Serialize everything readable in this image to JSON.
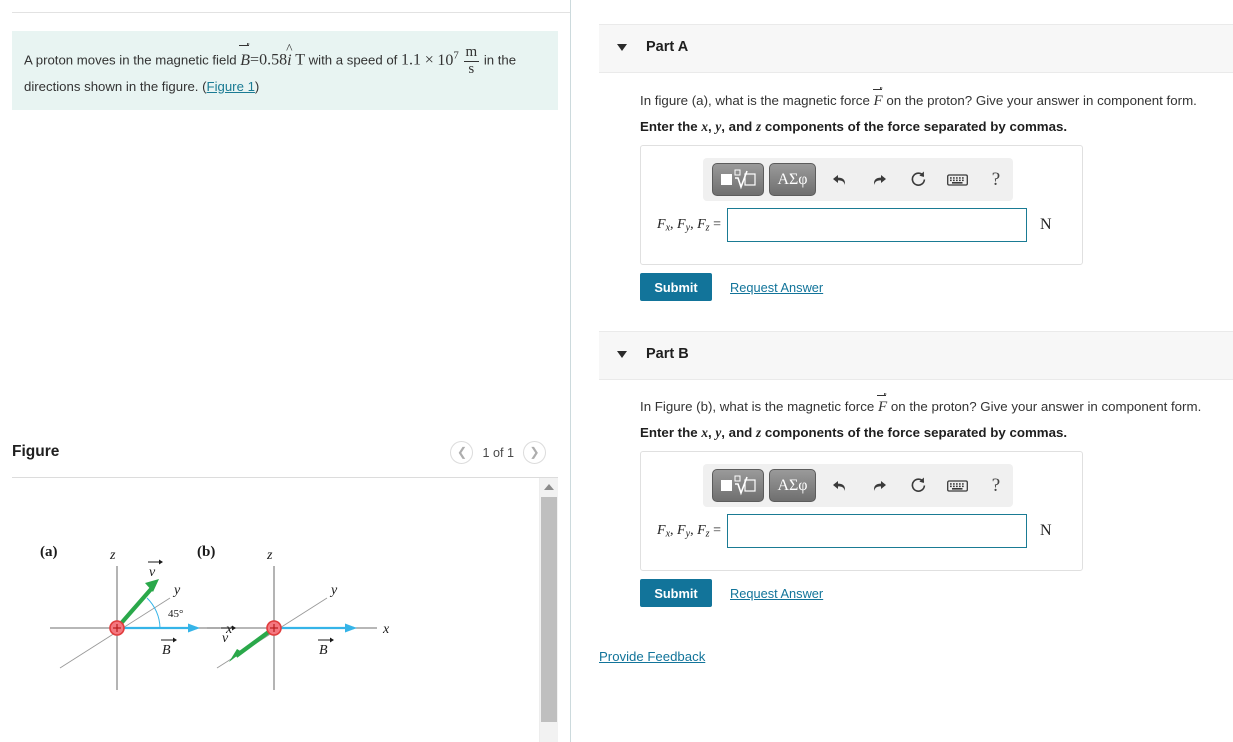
{
  "problem": {
    "text_before_B": "A proton moves in the magnetic field ",
    "B_symbol": "B",
    "equals": "=",
    "B_value": "0.58",
    "i_hat": "i",
    "hat_glyph": "^",
    "tesla_unit": "T",
    "text_mid": " with a speed of ",
    "speed_mantissa": "1.1",
    "times": "×",
    "speed_base": "10",
    "speed_exponent": "7",
    "speed_unit_num": "m",
    "speed_unit_den": "s",
    "text_after": " in the",
    "line2_before_link": "directions shown in the figure. (",
    "figure_link": "Figure 1",
    "line2_after_link": ")"
  },
  "figure": {
    "title": "Figure",
    "pager_label": "1 of 1",
    "prev_icon": "chevron-left-icon",
    "next_icon": "chevron-right-icon",
    "scroll_up_icon": "scroll-up-arrow-icon",
    "panels": [
      {
        "tag": "(a)",
        "axis_z": "z",
        "axis_y": "y",
        "axis_x": "x",
        "vector_v": "v",
        "vector_B": "B",
        "angle_label": "45°"
      },
      {
        "tag": "(b)",
        "axis_z": "z",
        "axis_y": "y",
        "axis_x": "x",
        "vector_v": "v",
        "vector_B": "B",
        "angle_label": ""
      }
    ],
    "colors": {
      "axis": "#8c8c8c",
      "velocity_vector": "#2aa84a",
      "field_vector": "#35b4e8",
      "proton": "#f4777f",
      "proton_stroke": "#e03c3c"
    }
  },
  "parts": [
    {
      "header_label": "Part A",
      "caret_icon": "caret-down-icon",
      "question_pre": "In figure (a), what is the magnetic force ",
      "question_symbol": "F",
      "question_post": " on the proton? Give your answer in component form.",
      "instruction_pre": "Enter the ",
      "instruction_x": "x",
      "instruction_sep1": ", ",
      "instruction_y": "y",
      "instruction_sep2": ", and ",
      "instruction_z": "z",
      "instruction_post": " components of the force separated by commas.",
      "toolbar": {
        "template_button": "template-tool-button",
        "template_glyph": "■",
        "radical_glyph": "√",
        "greek_button_label": "ΑΣφ",
        "undo_icon": "undo-arrow-icon",
        "redo_icon": "redo-arrow-icon",
        "reset_icon": "reset-circular-arrow-icon",
        "keyboard_icon": "keyboard-icon",
        "help_icon": "question-mark-help-icon",
        "help_glyph": "?"
      },
      "answer_label_F": "F",
      "answer_sub_x": "x",
      "answer_sub_y": "y",
      "answer_sub_z": "z",
      "answer_equals": "=",
      "answer_value": "",
      "answer_placeholder": "",
      "unit": "N",
      "submit_label": "Submit",
      "request_answer_label": "Request Answer"
    },
    {
      "header_label": "Part B",
      "caret_icon": "caret-down-icon",
      "question_pre": "In Figure (b), what is the magnetic force ",
      "question_symbol": "F",
      "question_post": " on the proton? Give your answer in component form.",
      "instruction_pre": "Enter the ",
      "instruction_x": "x",
      "instruction_sep1": ", ",
      "instruction_y": "y",
      "instruction_sep2": ", and ",
      "instruction_z": "z",
      "instruction_post": " components of the force separated by commas.",
      "toolbar": {
        "template_button": "template-tool-button",
        "template_glyph": "■",
        "radical_glyph": "√",
        "greek_button_label": "ΑΣφ",
        "undo_icon": "undo-arrow-icon",
        "redo_icon": "redo-arrow-icon",
        "reset_icon": "reset-circular-arrow-icon",
        "keyboard_icon": "keyboard-icon",
        "help_icon": "question-mark-help-icon",
        "help_glyph": "?"
      },
      "answer_label_F": "F",
      "answer_sub_x": "x",
      "answer_sub_y": "y",
      "answer_sub_z": "z",
      "answer_equals": "=",
      "answer_value": "",
      "answer_placeholder": "",
      "unit": "N",
      "submit_label": "Submit",
      "request_answer_label": "Request Answer"
    }
  ],
  "footer": {
    "provide_feedback": "Provide Feedback"
  },
  "theme": {
    "accent": "#12749a",
    "link": "#1a7b94",
    "problem_bg": "#e8f4f2",
    "header_bg": "#f7f7f7"
  }
}
